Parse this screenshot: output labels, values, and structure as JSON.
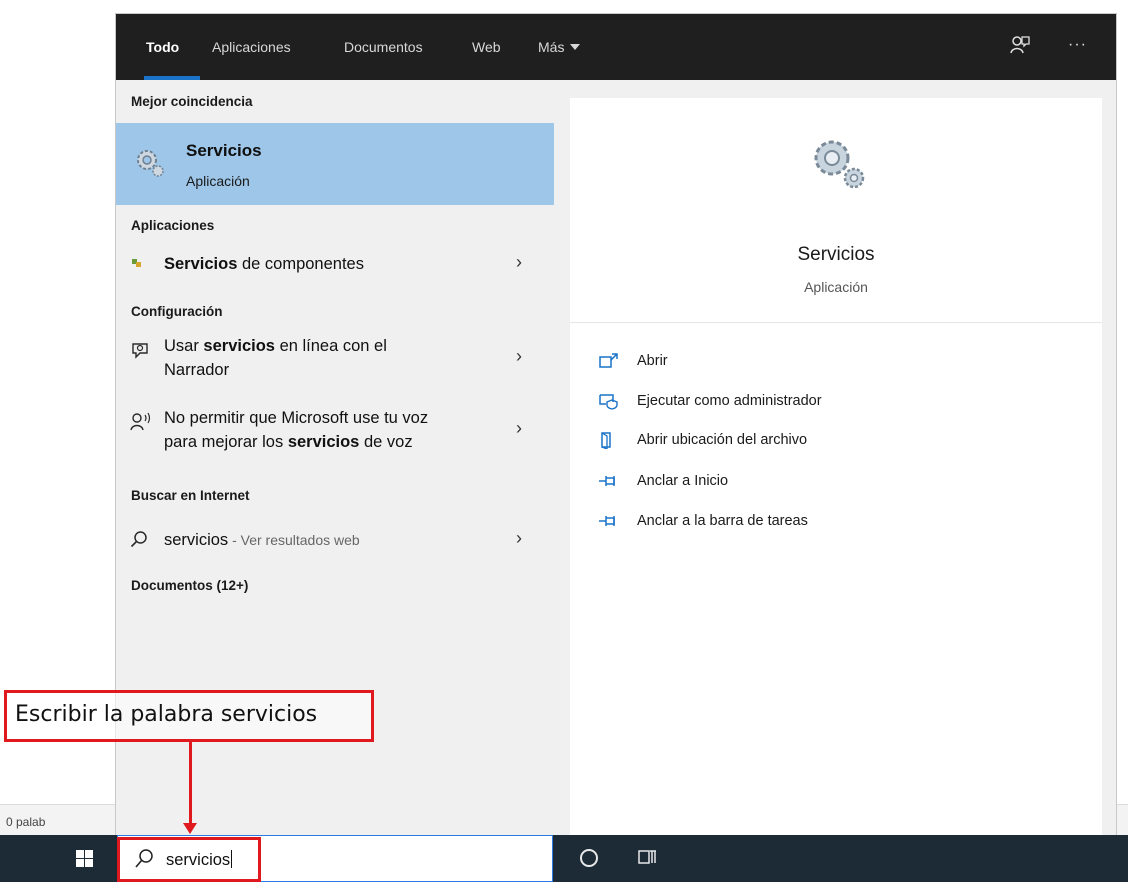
{
  "background_doc": {
    "status_text": "0 palab"
  },
  "tabs": [
    {
      "label": "Todo",
      "active": true
    },
    {
      "label": "Aplicaciones"
    },
    {
      "label": "Documentos"
    },
    {
      "label": "Web"
    },
    {
      "label": "Más"
    }
  ],
  "top_icons": {
    "feedback": "feedback-icon",
    "more": "···"
  },
  "sections": {
    "best_match": "Mejor coincidencia",
    "apps": "Aplicaciones",
    "settings": "Configuración",
    "web": "Buscar en Internet",
    "documents": "Documentos (12+)"
  },
  "best_match": {
    "title": "Servicios",
    "subtitle": "Aplicación",
    "icon": "gear-icon"
  },
  "apps": [
    {
      "bold": "Servicios",
      "rest": " de componentes",
      "icon": "component-services-icon"
    }
  ],
  "settings": [
    {
      "line1_pre": "Usar ",
      "line1_bold": "servicios",
      "line1_post": " en línea con el",
      "line2": "Narrador",
      "icon": "narrator-icon"
    },
    {
      "line1": "No permitir que Microsoft use tu voz",
      "line2_pre": "para mejorar los ",
      "line2_bold": "servicios",
      "line2_post": " de voz",
      "icon": "voice-icon"
    }
  ],
  "web": {
    "query": "servicios",
    "suffix": " - Ver resultados web",
    "icon": "search-icon"
  },
  "preview": {
    "title": "Servicios",
    "subtitle": "Aplicación",
    "actions": [
      {
        "label": "Abrir",
        "icon": "open-icon"
      },
      {
        "label": "Ejecutar como administrador",
        "icon": "run-as-admin-icon"
      },
      {
        "label": "Abrir ubicación del archivo",
        "icon": "file-location-icon"
      },
      {
        "label": "Anclar a Inicio",
        "icon": "pin-icon"
      },
      {
        "label": "Anclar a la barra de tareas",
        "icon": "pin-icon"
      }
    ]
  },
  "taskbar": {
    "search_value": "servicios"
  },
  "annotation": {
    "text": "Escribir la palabra servicios"
  },
  "colors": {
    "accent": "#1a73c9",
    "selection": "#9dc6e8",
    "annotation_red": "#e0191e",
    "taskbar": "#1c2b36"
  }
}
